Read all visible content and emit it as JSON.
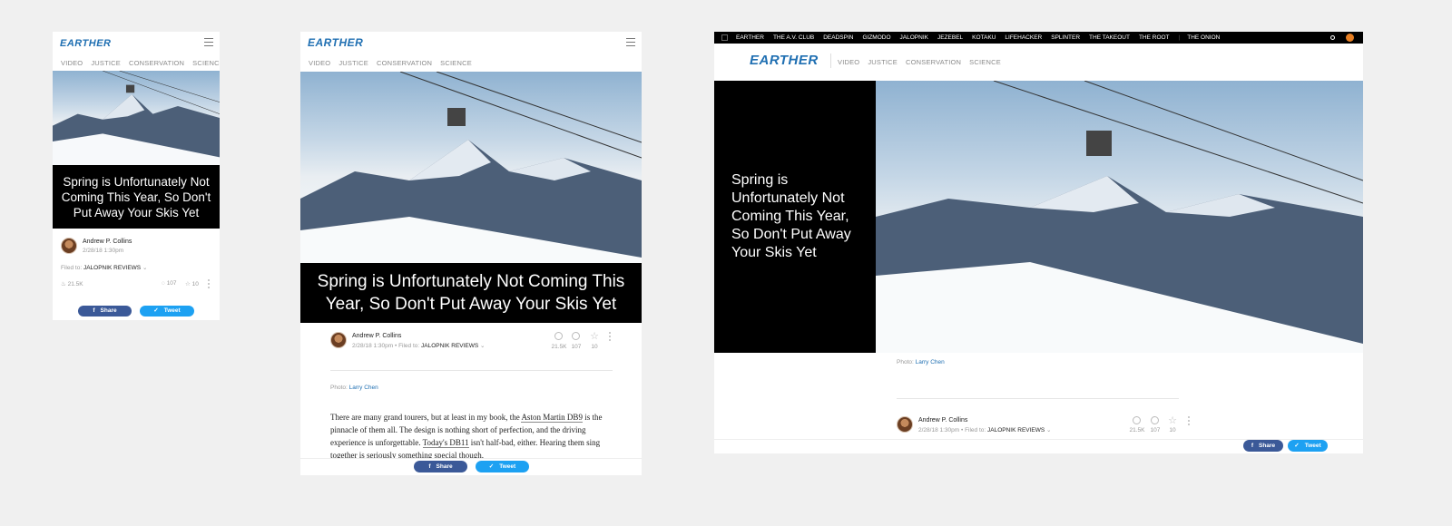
{
  "brand": {
    "logo": "EARTHER",
    "accent": "#1f6fb2"
  },
  "nav": [
    "VIDEO",
    "JUSTICE",
    "CONSERVATION",
    "SCIENCE"
  ],
  "network_bar": [
    "EARTHER",
    "THE A.V. CLUB",
    "DEADSPIN",
    "GIZMODO",
    "JALOPNIK",
    "JEZEBEL",
    "KOTAKU",
    "LIFEHACKER",
    "SPLINTER",
    "THE TAKEOUT",
    "THE ROOT",
    "THE ONION"
  ],
  "article": {
    "headline": "Spring is Unfortunately Not Coming This Year, So Don't Put Away Your Skis Yet",
    "author": "Andrew P. Collins",
    "date": "2/28/18 1:30pm",
    "filed_label": "Filed to:",
    "filed_value": "JALOPNIK REVIEWS",
    "views": "21.5K",
    "comments": "107",
    "stars": "10",
    "photo_label": "Photo:",
    "photo_credit": "Larry Chen",
    "body_1": "There are many grand tourers, but at least in my book, the ",
    "body_link1": "Aston Martin DB9",
    "body_2": " is the pinnacle of them all. The design is nothing short of perfection, and the driving experience is unforgettable. ",
    "body_link2": "Today's DB11",
    "body_3": " isn't half-bad, either. Hearing them sing together is seriously something special though."
  },
  "share": {
    "facebook": "Share",
    "twitter": "Tweet",
    "fb_icon": "f"
  },
  "icons": {
    "views": "flame-icon",
    "comments": "comment-icon",
    "stars": "star-icon"
  }
}
